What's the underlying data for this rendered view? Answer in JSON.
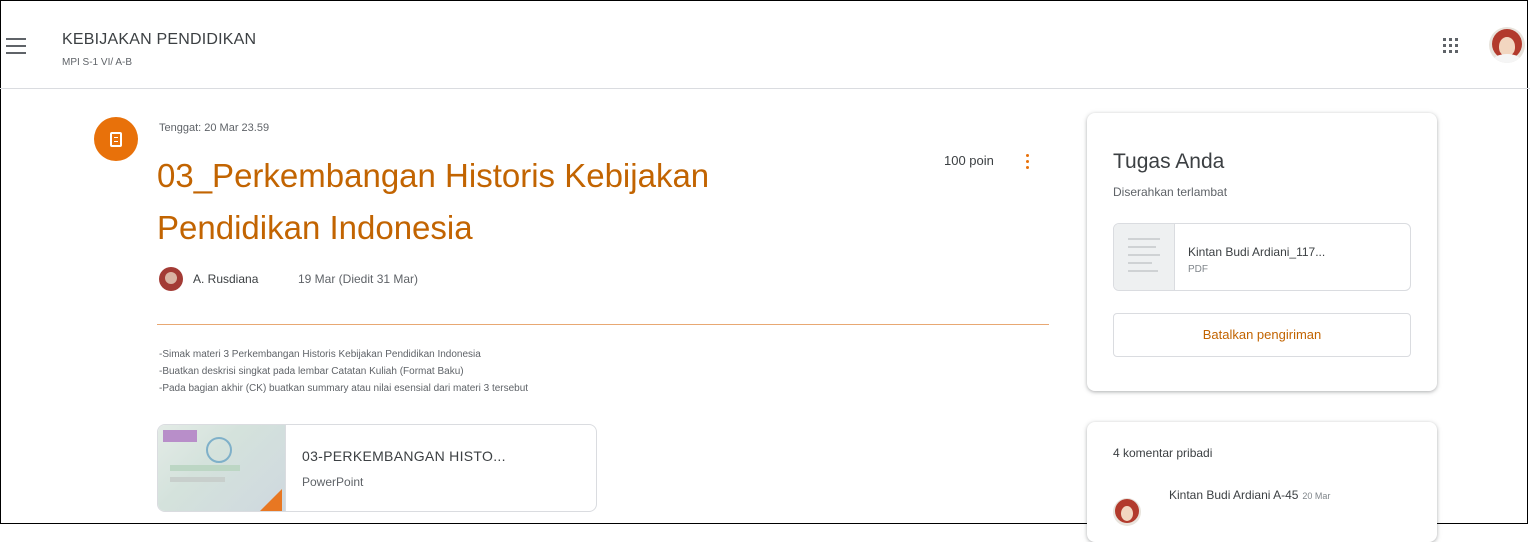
{
  "header": {
    "course_title": "KEBIJAKAN PENDIDIKAN",
    "course_subtitle": "MPI S-1 VI/ A-B",
    "menu_icon": "hamburger-menu-icon",
    "apps_icon": "google-apps-grid-icon"
  },
  "assignment": {
    "icon": "assignment-icon",
    "due": "Tenggat: 20 Mar 23.59",
    "title_line1": "03_Perkembangan Historis Kebijakan",
    "title_line2": "Pendidikan Indonesia",
    "points": "100 poin",
    "author": "A. Rusdiana",
    "posted": "19 Mar (Diedit 31 Mar)",
    "description": [
      "-Simak materi 3 Perkembangan Historis Kebijakan Pendidikan Indonesia",
      "-Buatkan deskrisi singkat pada lembar Catatan Kuliah (Format Baku)",
      "-Pada bagian akhir (CK) buatkan summary atau nilai esensial dari materi 3 tersebut"
    ],
    "attachment": {
      "name": "03-PERKEMBANGAN HISTO...",
      "type": "PowerPoint"
    },
    "accent_color": "#e8710a"
  },
  "your_work": {
    "title": "Tugas Anda",
    "status": "Diserahkan terlambat",
    "file": {
      "name": "Kintan Budi Ardiani_117...",
      "type": "PDF"
    },
    "unsubmit_label": "Batalkan pengiriman"
  },
  "comments": {
    "title": "4 komentar pribadi",
    "items": [
      {
        "author": "Kintan Budi Ardiani A-45",
        "date": "20 Mar"
      }
    ]
  }
}
